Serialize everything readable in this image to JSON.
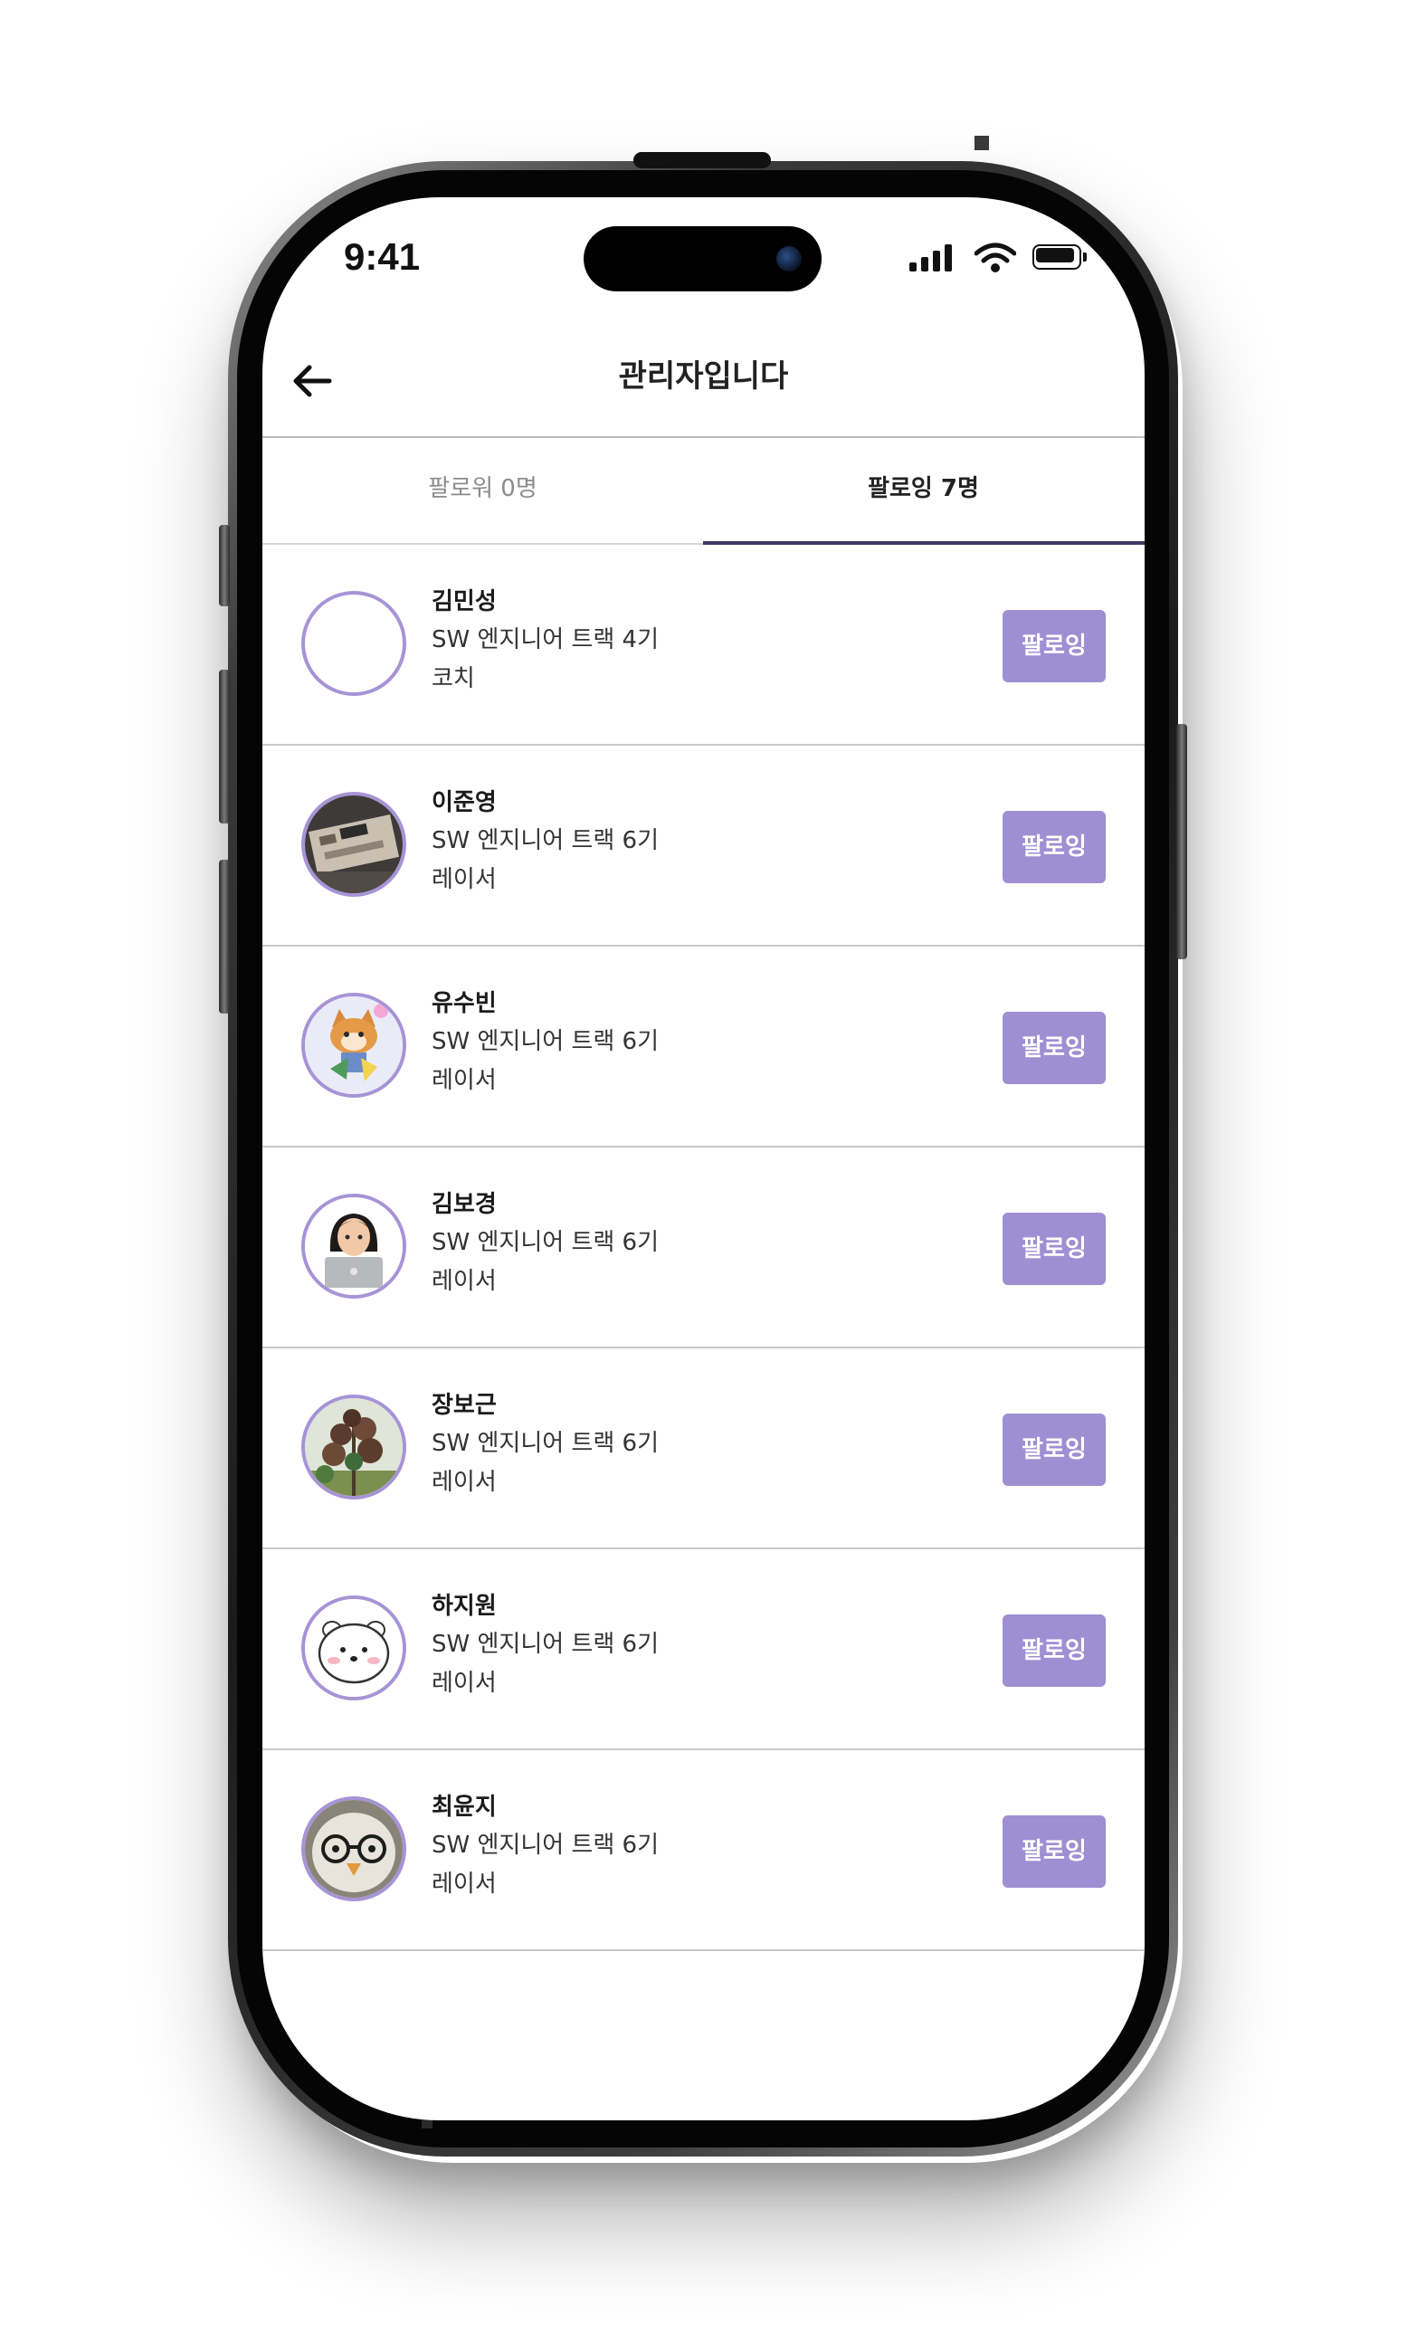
{
  "status_bar": {
    "time": "9:41"
  },
  "header": {
    "title": "관리자입니다",
    "back_icon": "arrow-left-icon"
  },
  "tabs": [
    {
      "label": "팔로워 0명",
      "active": false
    },
    {
      "label": "팔로잉 7명",
      "active": true
    }
  ],
  "colors": {
    "accent": "#9e8fd2",
    "avatar_border": "#a793d6",
    "tab_underline": "#3f3a64"
  },
  "following": [
    {
      "name": "김민성",
      "track": "SW 엔지니어 트랙 4기",
      "role": "코치",
      "button_label": "팔로잉",
      "avatar": "empty-avatar"
    },
    {
      "name": "이준영",
      "track": "SW 엔지니어 트랙 6기",
      "role": "레이서",
      "button_label": "팔로잉",
      "avatar": "keyboard-photo-avatar"
    },
    {
      "name": "유수빈",
      "track": "SW 엔지니어 트랙 6기",
      "role": "레이서",
      "button_label": "팔로잉",
      "avatar": "cartoon-character-avatar"
    },
    {
      "name": "김보경",
      "track": "SW 엔지니어 트랙 6기",
      "role": "레이서",
      "button_label": "팔로잉",
      "avatar": "memoji-laptop-avatar"
    },
    {
      "name": "장보근",
      "track": "SW 엔지니어 트랙 6기",
      "role": "레이서",
      "button_label": "팔로잉",
      "avatar": "plant-photo-avatar"
    },
    {
      "name": "하지원",
      "track": "SW 엔지니어 트랙 6기",
      "role": "레이서",
      "button_label": "팔로잉",
      "avatar": "white-bear-avatar"
    },
    {
      "name": "최윤지",
      "track": "SW 엔지니어 트랙 6기",
      "role": "레이서",
      "button_label": "팔로잉",
      "avatar": "bird-glasses-avatar"
    }
  ]
}
